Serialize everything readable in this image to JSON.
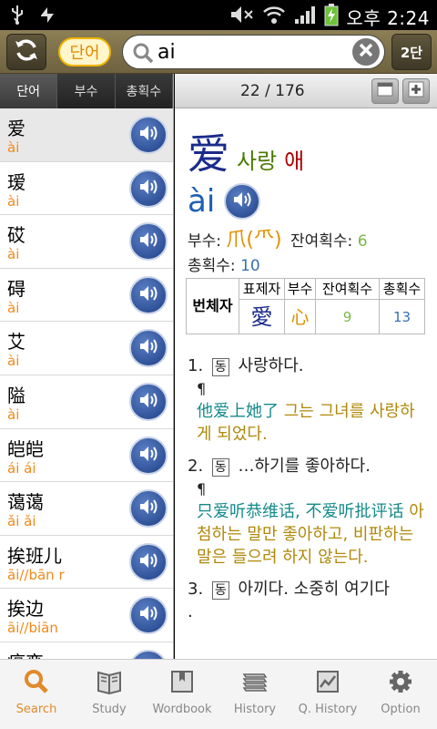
{
  "status_bar": {
    "time": "오후 2:24",
    "icons": [
      "usb-icon",
      "signal-strength-icon",
      "mute-icon",
      "wifi-icon",
      "cell-signal-icon",
      "battery-charging-icon"
    ]
  },
  "top_bar": {
    "refresh_icon": "refresh-icon",
    "mode_toggle_label": "단어",
    "search_value": "ai",
    "clear_icon": "clear-icon",
    "column_button_label": "2단"
  },
  "left_panel": {
    "tabs": [
      {
        "label": "단어",
        "active": true
      },
      {
        "label": "부수",
        "active": false
      },
      {
        "label": "총획수",
        "active": false
      }
    ],
    "items": [
      {
        "hanzi": "爱",
        "pinyin": "ài",
        "selected": true
      },
      {
        "hanzi": "瑷",
        "pinyin": "ài",
        "selected": false
      },
      {
        "hanzi": "砹",
        "pinyin": "ài",
        "selected": false
      },
      {
        "hanzi": "碍",
        "pinyin": "ài",
        "selected": false
      },
      {
        "hanzi": "艾",
        "pinyin": "ài",
        "selected": false
      },
      {
        "hanzi": "隘",
        "pinyin": "ài",
        "selected": false
      },
      {
        "hanzi": "皑皑",
        "pinyin": "ái ái",
        "selected": false
      },
      {
        "hanzi": "蔼蔼",
        "pinyin": "ǎi ǎi",
        "selected": false
      },
      {
        "hanzi": "挨班儿",
        "pinyin": "āi//bān r",
        "selected": false
      },
      {
        "hanzi": "挨边",
        "pinyin": "āi//biān",
        "selected": false
      },
      {
        "hanzi": "癌变",
        "pinyin": "",
        "selected": false
      }
    ]
  },
  "right_panel": {
    "counter": "22 / 176",
    "entry": {
      "hanzi": "爱",
      "korean_meaning": "사랑",
      "korean_reading": "애",
      "pinyin": "ài",
      "radical_label": "부수:",
      "radical": "爪(⺥)",
      "remaining_strokes_label": "잔여획수:",
      "remaining_strokes": "6",
      "total_strokes_label": "총획수:",
      "total_strokes": "10",
      "variant_table": {
        "row_header": "번체자",
        "headers": [
          "표제자",
          "부수",
          "잔여획수",
          "총획수"
        ],
        "values": [
          "愛",
          "心",
          "9",
          "13"
        ]
      }
    },
    "senses": [
      {
        "num": "1.",
        "pos": "동",
        "meaning": "사랑하다.",
        "example_zh": "他爱上她了",
        "example_ko": "그는 그녀를 사랑하게 되었다."
      },
      {
        "num": "2.",
        "pos": "동",
        "meaning": "…하기를 좋아하다.",
        "example_zh": "只爱听恭维话, 不爱听批评话",
        "example_ko": "아첨하는 말만 좋아하고, 비판하는 말은 들으려 하지 않는다."
      },
      {
        "num": "3.",
        "pos": "동",
        "meaning": "아끼다. 소중히 여기다"
      }
    ],
    "sense3_trailing": "."
  },
  "bottom_nav": [
    {
      "label": "Search",
      "icon": "search-icon",
      "active": true
    },
    {
      "label": "Study",
      "icon": "book-icon",
      "active": false
    },
    {
      "label": "Wordbook",
      "icon": "wordbook-icon",
      "active": false
    },
    {
      "label": "History",
      "icon": "history-icon",
      "active": false
    },
    {
      "label": "Q. History",
      "icon": "chart-icon",
      "active": false
    },
    {
      "label": "Option",
      "icon": "gear-icon",
      "active": false
    }
  ],
  "colors": {
    "accent": "#e08a2a",
    "pinyin_list": "#f08a1c",
    "headword": "#1b2b8a"
  }
}
